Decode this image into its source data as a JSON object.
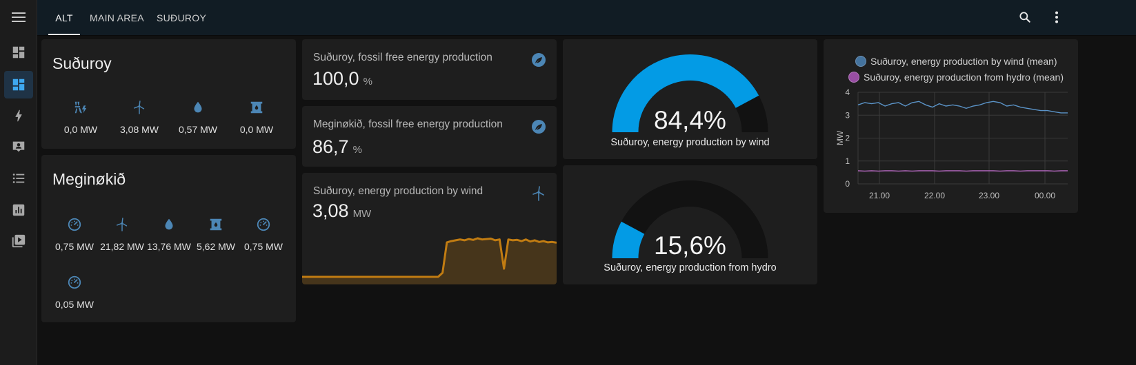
{
  "header": {
    "tabs": [
      {
        "label": "ALT",
        "active": true
      },
      {
        "label": "MAIN AREA",
        "active": false
      },
      {
        "label": "SUÐUROY",
        "active": false
      }
    ],
    "icons": [
      "search-icon",
      "more-vert-icon"
    ]
  },
  "sidebar": {
    "menu_icon": "menu-icon",
    "items": [
      {
        "icon": "view-dashboard-outline-icon",
        "active": false
      },
      {
        "icon": "view-dashboard-icon",
        "active": true
      },
      {
        "icon": "lightning-bolt-icon",
        "active": false
      },
      {
        "icon": "account-box-icon",
        "active": false
      },
      {
        "icon": "format-list-bulleted-icon",
        "active": false
      },
      {
        "icon": "chart-box-icon",
        "active": false
      },
      {
        "icon": "play-box-multiple-icon",
        "active": false
      }
    ]
  },
  "suduroy": {
    "title": "Suðuroy",
    "entities": [
      {
        "icon": "transmission-tower-lightning-icon",
        "value": "0,0 MW"
      },
      {
        "icon": "wind-turbine-icon",
        "value": "3,08 MW"
      },
      {
        "icon": "water-icon",
        "value": "0,57 MW"
      },
      {
        "icon": "barrel-icon",
        "value": "0,0 MW"
      }
    ]
  },
  "meginokid": {
    "title": "Meginøkið",
    "entities": [
      {
        "icon": "gauge-icon",
        "value": "0,75 MW"
      },
      {
        "icon": "wind-turbine-icon",
        "value": "21,82 MW"
      },
      {
        "icon": "water-icon",
        "value": "13,76 MW"
      },
      {
        "icon": "barrel-icon",
        "value": "5,62 MW"
      },
      {
        "icon": "gauge-icon",
        "value": "0,75 MW"
      },
      {
        "icon": "gauge-icon",
        "value": "0,05 MW"
      }
    ]
  },
  "fossil_suduroy": {
    "name": "Suðuroy, fossil free energy production",
    "value": "100,0",
    "unit": "%",
    "icon": "leaf-circle-icon"
  },
  "fossil_megin": {
    "name": "Meginøkið, fossil free energy production",
    "value": "86,7",
    "unit": "%",
    "icon": "leaf-circle-icon"
  },
  "wind_sensor": {
    "name": "Suðuroy, energy production by wind",
    "value": "3,08",
    "unit": "MW",
    "icon": "wind-turbine-icon",
    "color": "#c17c12"
  },
  "gauge_wind": {
    "value_text": "84,4%",
    "fraction": 0.844,
    "label": "Suðuroy, energy production by wind",
    "color": "#039be5"
  },
  "gauge_hydro": {
    "value_text": "15,6%",
    "fraction": 0.156,
    "label": "Suðuroy, energy production from hydro",
    "color": "#039be5"
  },
  "history": {
    "legend": [
      {
        "name": "Suðuroy, energy production by wind (mean)",
        "color": "#44739e"
      },
      {
        "name": "Suðuroy, energy production from hydro (mean)",
        "color": "#984ea3"
      }
    ],
    "ylabel": "MW",
    "yticks": [
      "0",
      "1",
      "2",
      "3",
      "4"
    ],
    "xticks": [
      "21.00",
      "22.00",
      "23.00",
      "00.00"
    ]
  },
  "chart_data": {
    "type": "line",
    "ylabel": "MW",
    "ylim": [
      0,
      4
    ],
    "x_ticks": [
      "21.00",
      "22.00",
      "23.00",
      "00.00"
    ],
    "grid": true,
    "legend": "top",
    "series": [
      {
        "name": "Suðuroy, energy production by wind (mean)",
        "color": "#44739e",
        "values": [
          3.45,
          3.55,
          3.5,
          3.55,
          3.4,
          3.5,
          3.55,
          3.4,
          3.55,
          3.6,
          3.45,
          3.35,
          3.5,
          3.4,
          3.45,
          3.4,
          3.3,
          3.4,
          3.45,
          3.55,
          3.6,
          3.55,
          3.4,
          3.45,
          3.35,
          3.3,
          3.25,
          3.2,
          3.2,
          3.15,
          3.1,
          3.1
        ]
      },
      {
        "name": "Suðuroy, energy production from hydro (mean)",
        "color": "#984ea3",
        "values": [
          0.57,
          0.56,
          0.57,
          0.56,
          0.57,
          0.57,
          0.56,
          0.57,
          0.56,
          0.57,
          0.57,
          0.57,
          0.56,
          0.57,
          0.57,
          0.57,
          0.56,
          0.57,
          0.57,
          0.57,
          0.57,
          0.56,
          0.57,
          0.57,
          0.56,
          0.57,
          0.57,
          0.57,
          0.57,
          0.56,
          0.57,
          0.57
        ]
      }
    ]
  },
  "sparkline": {
    "values": [
      0,
      0,
      0,
      0,
      0,
      0,
      0,
      0,
      0,
      0,
      0,
      0,
      0,
      0,
      0,
      0,
      0,
      0,
      0,
      0,
      0,
      0,
      0,
      0,
      0,
      0,
      0,
      0,
      0,
      0,
      0,
      0,
      0.1,
      0.85,
      0.88,
      0.9,
      0.92,
      0.9,
      0.93,
      0.91,
      0.95,
      0.92,
      0.93,
      0.94,
      0.9,
      0.92,
      0.2,
      0.92,
      0.9,
      0.91,
      0.88,
      0.92,
      0.87,
      0.9,
      0.86,
      0.88,
      0.85,
      0.86,
      0.84
    ]
  }
}
